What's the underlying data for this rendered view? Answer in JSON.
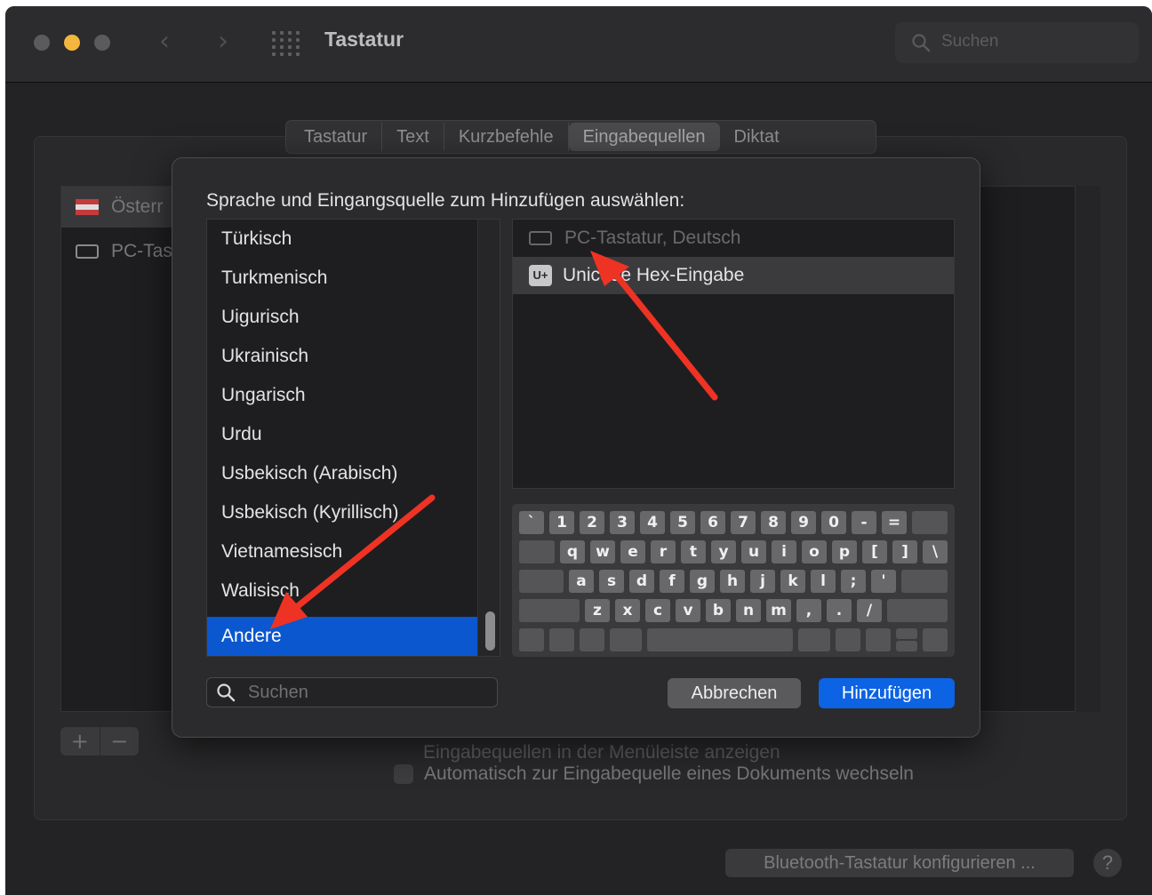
{
  "window": {
    "title": "Tastatur",
    "search_placeholder": "Suchen"
  },
  "tabs": [
    "Tastatur",
    "Text",
    "Kurzbefehle",
    "Eingabequellen",
    "Diktat"
  ],
  "active_tab": "Eingabequellen",
  "background_list": [
    {
      "label": "Österr",
      "icon": "austria-flag-icon"
    },
    {
      "label": "PC-Tas",
      "icon": "keyboard-icon"
    }
  ],
  "plus_label": "+",
  "minus_label": "−",
  "hidden_option": "Eingabequellen in der Menüleiste anzeigen",
  "auto_switch_label": "Automatisch zur Eingabequelle eines Dokuments wechseln",
  "bluetooth_button": "Bluetooth-Tastatur konfigurieren ...",
  "help_label": "?",
  "dialog": {
    "title": "Sprache und Eingangsquelle zum Hinzufügen auswählen:",
    "languages": [
      "Türkisch",
      "Turkmenisch",
      "Uigurisch",
      "Ukrainisch",
      "Ungarisch",
      "Urdu",
      "Usbekisch (Arabisch)",
      "Usbekisch (Kyrillisch)",
      "Vietnamesisch",
      "Walisisch",
      "Andere"
    ],
    "selected_language": "Andere",
    "sources": [
      {
        "label": "PC-Tastatur, Deutsch",
        "icon": "keyboard-icon",
        "state": "disabled"
      },
      {
        "label": "Unicode Hex-Eingabe",
        "icon": "unicode-icon",
        "icon_text": "U+",
        "state": "highlighted"
      }
    ],
    "keyboard_rows": [
      [
        "`",
        "1",
        "2",
        "3",
        "4",
        "5",
        "6",
        "7",
        "8",
        "9",
        "0",
        "-",
        "="
      ],
      [
        "q",
        "w",
        "e",
        "r",
        "t",
        "y",
        "u",
        "i",
        "o",
        "p",
        "[",
        "]",
        "\\"
      ],
      [
        "a",
        "s",
        "d",
        "f",
        "g",
        "h",
        "j",
        "k",
        "l",
        ";",
        "'"
      ],
      [
        "z",
        "x",
        "c",
        "v",
        "b",
        "n",
        "m",
        ",",
        ".",
        "/"
      ]
    ],
    "search_placeholder": "Suchen",
    "cancel_label": "Abbrechen",
    "add_label": "Hinzufügen"
  },
  "colors": {
    "accent": "#0c63e4",
    "selection": "#0a57cf",
    "annotation_arrow": "#ee3324"
  }
}
